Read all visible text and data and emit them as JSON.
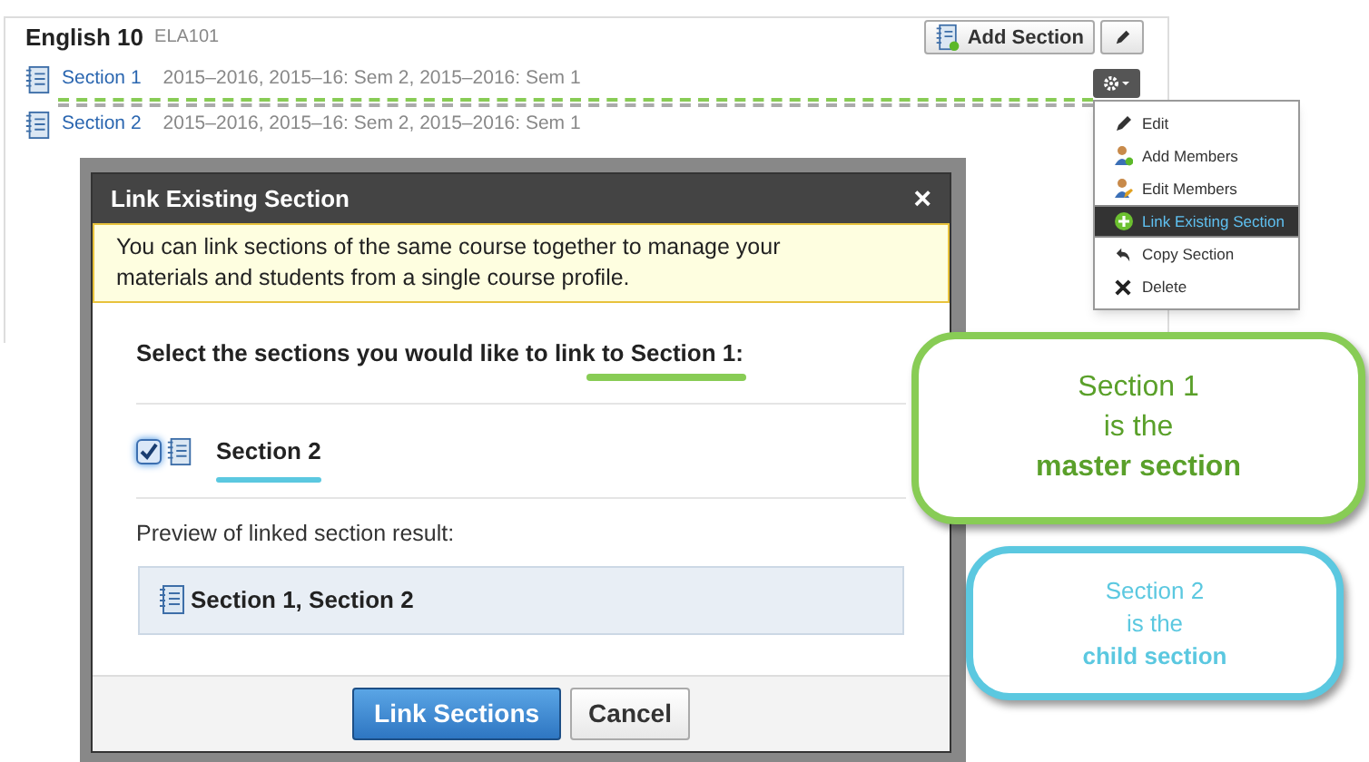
{
  "course": {
    "title": "English 10",
    "code": "ELA101",
    "add_button": "Add Section",
    "sections": [
      {
        "name": "Section 1",
        "terms": "2015–2016, 2015–16: Sem 2, 2015–2016: Sem 1",
        "highlighted": true
      },
      {
        "name": "Section 2",
        "terms": "2015–2016, 2015–16: Sem 2, 2015–2016: Sem 1",
        "highlighted": false
      }
    ]
  },
  "menu": {
    "items": [
      {
        "label": "Edit",
        "selected": false
      },
      {
        "label": "Add Members",
        "selected": false
      },
      {
        "label": "Edit Members",
        "selected": false
      },
      {
        "label": "Link Existing Section",
        "selected": true
      },
      {
        "label": "Copy Section",
        "selected": false
      },
      {
        "label": "Delete",
        "selected": false
      }
    ]
  },
  "dialog": {
    "title": "Link Existing Section",
    "close": "×",
    "notice": "You can link sections of the same course together to manage your materials and students from a single course profile.",
    "prompt": "Select the sections you would like to link ",
    "prompt_target": "to Section 1:",
    "sections": [
      {
        "label": "Section 2",
        "checked": true
      }
    ],
    "preview_label": "Preview of linked section result:",
    "preview_value": "Section 1, Section 2",
    "buttons": [
      "Link Sections",
      "Cancel"
    ]
  },
  "callouts": [
    {
      "text": "Section 1\nis the\n**master section**",
      "color": "#88cc55"
    },
    {
      "text": "Section 2\nis the\n**child section**",
      "color": "#5bc8e0"
    }
  ]
}
